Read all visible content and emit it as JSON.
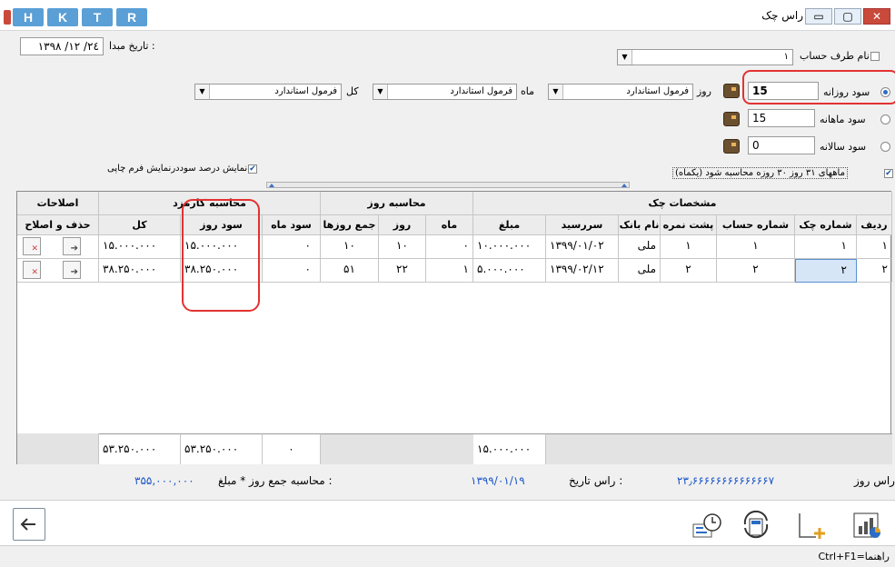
{
  "window": {
    "title": "راس چک",
    "hk_buttons": [
      "H",
      "K",
      "T",
      "R"
    ],
    "controls": {
      "minimize": "▭",
      "restore": "▢",
      "close": "✕"
    }
  },
  "filters": {
    "account_party_label": "نام طرف حساب",
    "account_party_value": "۱",
    "start_date_label": "تاریخ مبدا :",
    "start_date_value": "۱۳۹۸ /۱۲ /۲٤"
  },
  "profit": {
    "daily_label": "سود روزانه",
    "daily_value": "15",
    "monthly_label": "سود ماهانه",
    "monthly_value": "15",
    "yearly_label": "سود سالانه",
    "yearly_value": "0",
    "selected": "daily"
  },
  "formulas": {
    "day_label": "روز",
    "day_value": "فرمول استاندارد",
    "month_label": "ماه",
    "month_value": "فرمول استاندارد",
    "total_label": "کل",
    "total_value": "فرمول استاندارد"
  },
  "options": {
    "months_31_30": "ماههای ۳۱ روز ۳۰ روزه محاسبه شود (یکماه)",
    "show_percent": "نمایش درصد سوددرنمایش فرم چاپی"
  },
  "grid": {
    "groups": {
      "check_specs": "مشخصات چک",
      "day_calc": "محاسبه روز",
      "fee_calc": "محاسبه کارمزد",
      "edits": "اصلاحات"
    },
    "columns": {
      "row": "ردیف",
      "check_no": "شماره چک",
      "account_no": "شماره حساب",
      "back_no": "پشت نمره",
      "bank": "نام بانک",
      "due": "سررسید",
      "amount": "مبلغ",
      "month": "ماه",
      "day": "روز",
      "days_sum": "جمع روزها",
      "month_profit": "سود ماه",
      "day_profit": "سود روز",
      "total": "کل",
      "edit_delete": "حذف و اصلاح"
    },
    "rows": [
      {
        "row": "۱",
        "check_no": "۱",
        "account_no": "۱",
        "back_no": "۱",
        "bank": "ملی",
        "due": "۱۳۹۹/۰۱/۰۲",
        "amount": "۱۰.۰۰۰.۰۰۰",
        "month": "۰",
        "day": "۱۰",
        "days_sum": "۱۰",
        "month_profit": "۰",
        "day_profit": "۱۵.۰۰۰.۰۰۰",
        "total": "۱۵.۰۰۰.۰۰۰"
      },
      {
        "row": "۲",
        "check_no": "۲",
        "account_no": "۲",
        "back_no": "۲",
        "bank": "ملی",
        "due": "۱۳۹۹/۰۲/۱۲",
        "amount": "۵.۰۰۰.۰۰۰",
        "month": "۱",
        "day": "۲۲",
        "days_sum": "۵۱",
        "month_profit": "۰",
        "day_profit": "۳۸.۲۵۰.۰۰۰",
        "total": "۳۸.۲۵۰.۰۰۰"
      }
    ],
    "footer": {
      "amount": "۱۵.۰۰۰.۰۰۰",
      "month_profit": "۰",
      "day_profit": "۵۳.۲۵۰.۰۰۰",
      "total": "۵۳.۲۵۰.۰۰۰"
    }
  },
  "summary": {
    "ras_day_label": "راس روز :",
    "ras_day_value": "۲۳٫۶۶۶۶۶۶۶۶۶۶۶۶۶۷",
    "ras_date_label": "راس تاریخ :",
    "ras_date_value": "۱۳۹۹/۰۱/۱۹",
    "calc_label": "محاسبه جمع روز * مبلغ :",
    "calc_value": "۳۵۵,۰۰۰,۰۰۰"
  },
  "status": {
    "help": "Ctrl+F1=راهنما"
  }
}
